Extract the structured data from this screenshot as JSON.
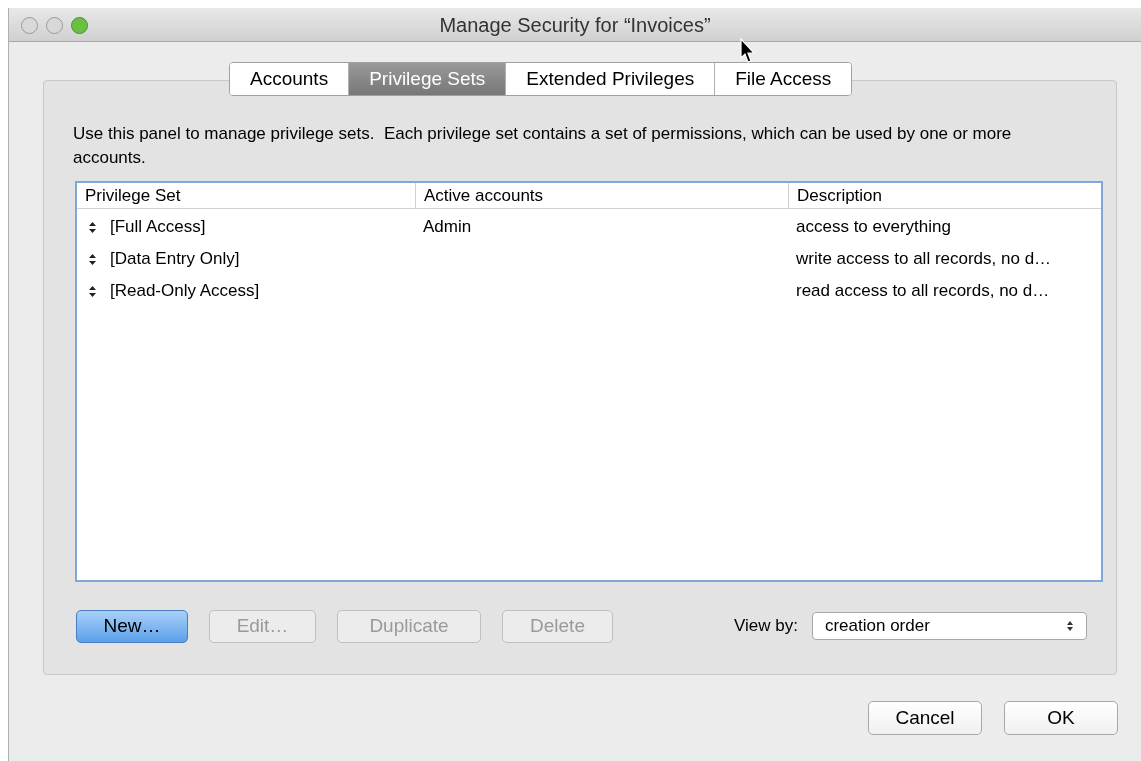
{
  "window": {
    "title": "Manage Security for “Invoices”"
  },
  "tabs": [
    {
      "label": "Accounts",
      "selected": false
    },
    {
      "label": "Privilege Sets",
      "selected": true
    },
    {
      "label": "Extended Privileges",
      "selected": false
    },
    {
      "label": "File Access",
      "selected": false
    }
  ],
  "description": "Use this panel to manage privilege sets.  Each privilege set contains a set of permissions, which can be used by one or more accounts.",
  "table": {
    "columns": [
      "Privilege Set",
      "Active accounts",
      "Description"
    ],
    "rows": [
      [
        "[Full Access]",
        "Admin",
        "access to everything"
      ],
      [
        "[Data Entry Only]",
        "",
        "write access to all records, no d…"
      ],
      [
        "[Read-Only Access]",
        "",
        "read access to all records, no d…"
      ]
    ]
  },
  "buttons": [
    {
      "label": "New…",
      "default": true,
      "disabled": false
    },
    {
      "label": "Edit…",
      "default": false,
      "disabled": true
    },
    {
      "label": "Duplicate",
      "default": false,
      "disabled": true
    },
    {
      "label": "Delete",
      "default": false,
      "disabled": true
    }
  ],
  "view_by": {
    "label": "View by:",
    "value": "creation order"
  },
  "footer_buttons": [
    {
      "label": "Cancel"
    },
    {
      "label": "OK"
    }
  ]
}
